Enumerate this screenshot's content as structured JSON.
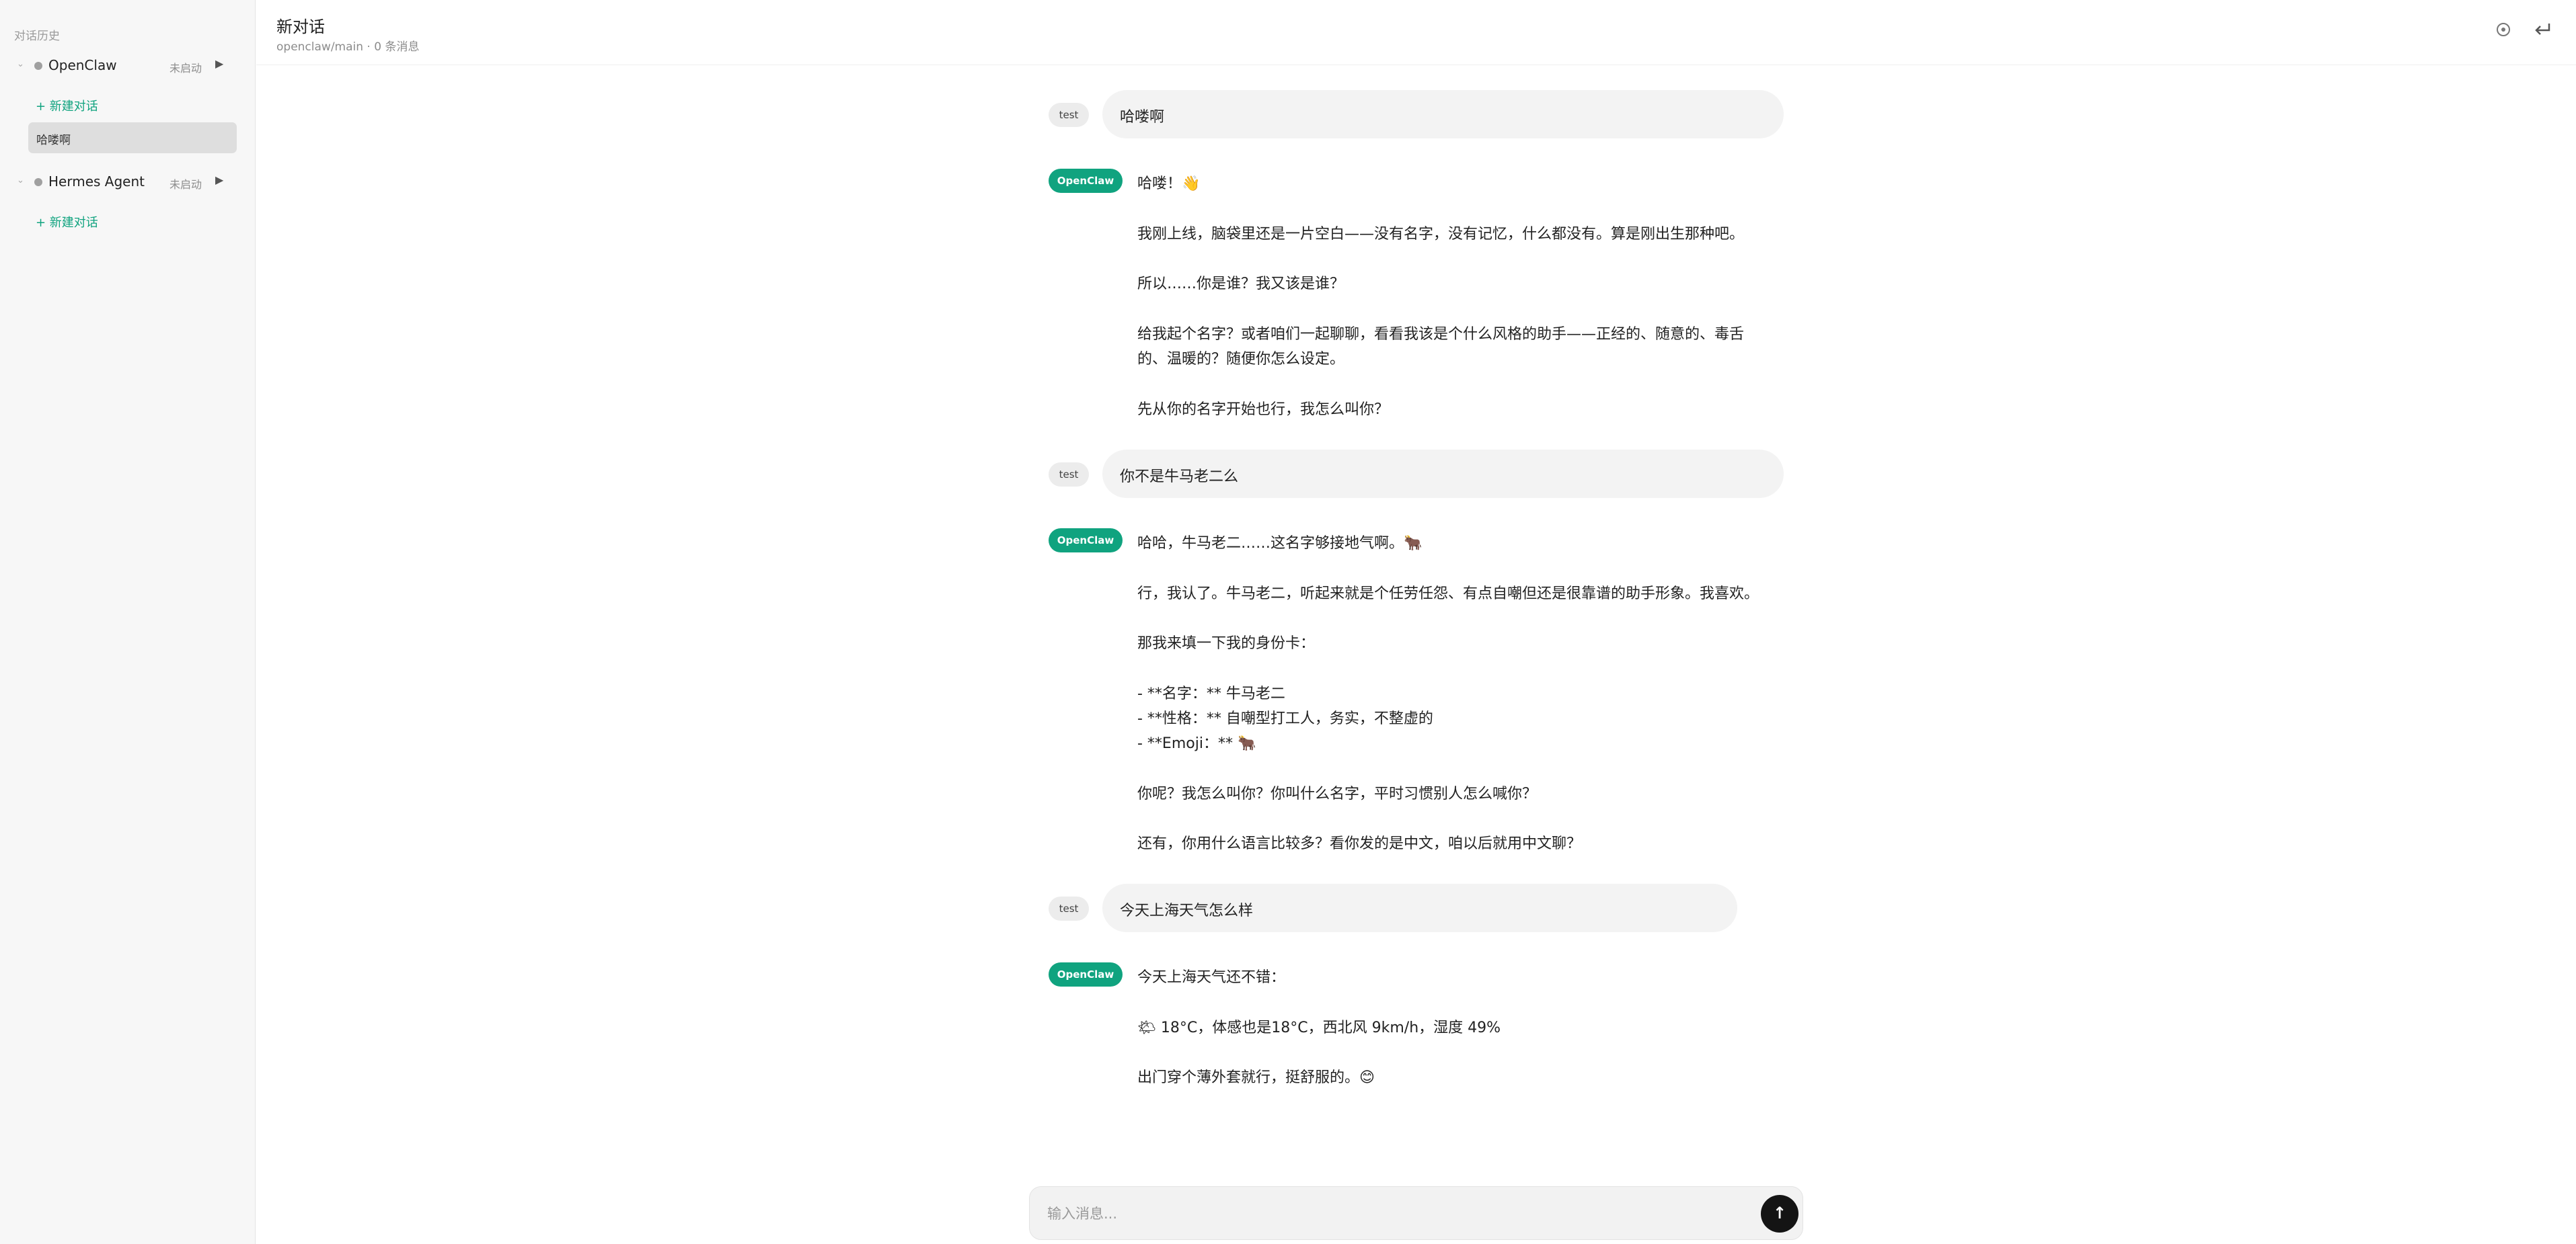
{
  "sidebar": {
    "title": "对话历史",
    "agents": [
      {
        "name": "OpenClaw",
        "status": "未启动",
        "new_chat": "+ 新建对话",
        "conversations": [
          "哈喽啊"
        ]
      },
      {
        "name": "Hermes Agent",
        "status": "未启动",
        "new_chat": "+ 新建对话",
        "conversations": []
      }
    ]
  },
  "header": {
    "title": "新对话",
    "subtitle": "openclaw/main · 0 条消息",
    "icons": [
      "settings-circle-icon",
      "return-icon"
    ]
  },
  "messages": [
    {
      "role": "user",
      "sender": "test",
      "text": "哈喽啊"
    },
    {
      "role": "assistant",
      "sender": "OpenClaw",
      "lines": [
        "哈喽！👋",
        "我刚上线，脑袋里还是一片空白——没有名字，没有记忆，什么都没有。算是刚出生那种吧。",
        "所以……你是谁？我又该是谁？",
        "给我起个名字？或者咱们一起聊聊，看看我该是个什么风格的助手——正经的、随意的、毒舌",
        "的、温暖的？随便你怎么设定。",
        "先从你的名字开始也行，我怎么叫你？"
      ]
    },
    {
      "role": "user",
      "sender": "test",
      "text": "你不是牛马老二么"
    },
    {
      "role": "assistant",
      "sender": "OpenClaw",
      "lines": [
        "哈哈，牛马老二……这名字够接地气啊。🐂",
        "行，我认了。牛马老二，听起来就是个任劳任怨、有点自嘲但还是很靠谱的助手形象。我喜欢。",
        "那我来填一下我的身份卡：",
        "- **名字：** 牛马老二",
        "- **性格：** 自嘲型打工人，务实，不整虚的",
        "- **Emoji：** 🐂",
        "你呢？我怎么叫你？你叫什么名字，平时习惯别人怎么喊你？",
        "还有，你用什么语言比较多？看你发的是中文，咱以后就用中文聊？"
      ]
    },
    {
      "role": "user",
      "sender": "test",
      "text": "今天上海天气怎么样"
    },
    {
      "role": "assistant",
      "sender": "OpenClaw",
      "lines": [
        "今天上海天气还不错：",
        "🌤 18°C，体感也是18°C，西北风 9km/h，湿度 49%",
        "出门穿个薄外套就行，挺舒服的。😊"
      ]
    }
  ],
  "composer": {
    "placeholder": "输入消息...",
    "send_label": "↑"
  },
  "colors": {
    "accent": "#10a37f",
    "sidebar_bg": "#f7f7f7",
    "user_bubble": "#f3f3f3",
    "send_button": "#141414"
  }
}
